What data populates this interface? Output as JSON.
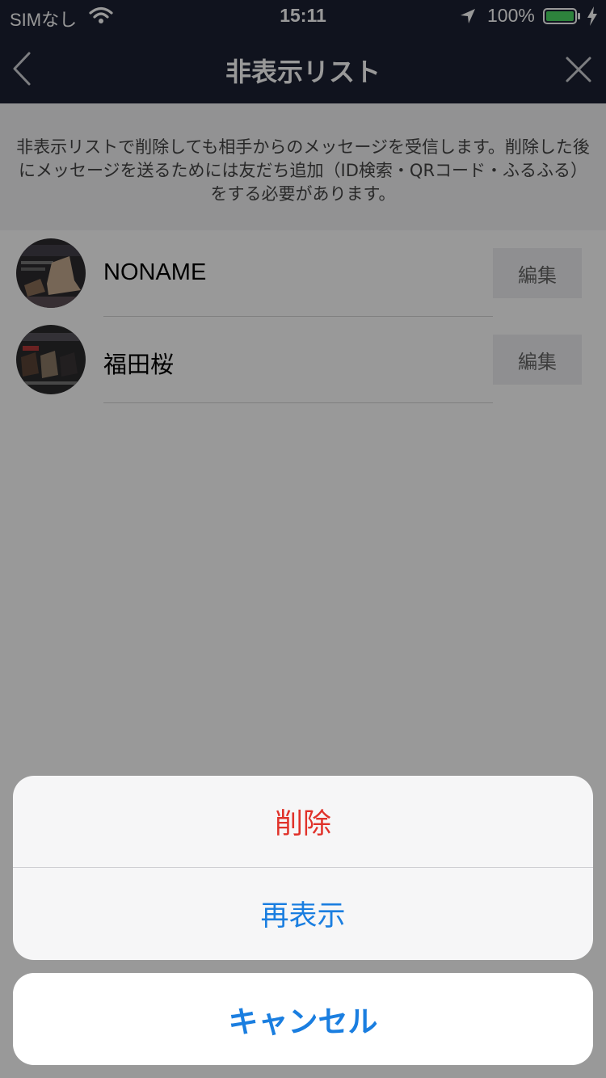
{
  "status_bar": {
    "carrier": "SIMなし",
    "time": "15:11",
    "battery_percent": "100%",
    "battery_level": 1.0,
    "icons": [
      "wifi-icon",
      "location-arrow-icon",
      "battery-icon",
      "charging-bolt-icon"
    ]
  },
  "nav": {
    "title": "非表示リスト",
    "back_icon": "chevron-left-icon",
    "close_icon": "close-icon"
  },
  "notice": {
    "text": "非表示リストで削除しても相手からのメッセージを受信します。削除した後にメッセージを送るためには友だち追加（ID検索・QRコード・ふるふる）をする必要があります。"
  },
  "contacts": [
    {
      "name": "NONAME",
      "edit_label": "編集"
    },
    {
      "name": "福田桜",
      "edit_label": "編集"
    }
  ],
  "action_sheet": {
    "delete_label": "削除",
    "unhide_label": "再表示",
    "cancel_label": "キャンセル"
  },
  "colors": {
    "nav_background": "#1c2133",
    "destructive": "#e0322a",
    "action": "#1a7ee0"
  }
}
